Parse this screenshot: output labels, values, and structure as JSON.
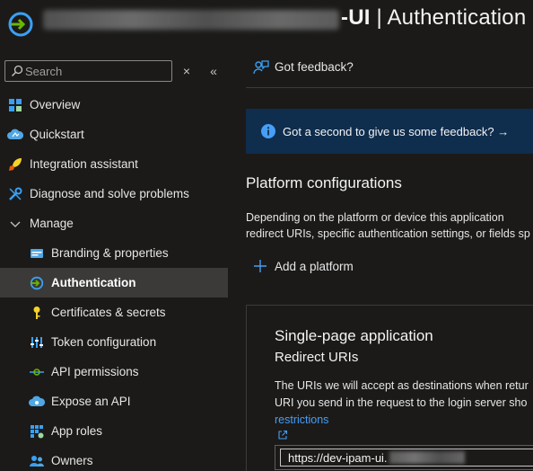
{
  "header": {
    "title_suffix_bold": "-UI",
    "separator": " | ",
    "blade_title": "Authentication"
  },
  "sidebar": {
    "search_placeholder": "Search",
    "close_glyph": "×",
    "collapse_glyph": "«",
    "items": [
      {
        "label": "Overview"
      },
      {
        "label": "Quickstart"
      },
      {
        "label": "Integration assistant"
      },
      {
        "label": "Diagnose and solve problems"
      },
      {
        "label": "Manage"
      },
      {
        "label": "Branding & properties"
      },
      {
        "label": "Authentication"
      },
      {
        "label": "Certificates & secrets"
      },
      {
        "label": "Token configuration"
      },
      {
        "label": "API permissions"
      },
      {
        "label": "Expose an API"
      },
      {
        "label": "App roles"
      },
      {
        "label": "Owners"
      }
    ]
  },
  "commandbar": {
    "feedback_label": "Got feedback?"
  },
  "banner": {
    "text": "Got a second to give us some feedback? →"
  },
  "platform": {
    "heading": "Platform configurations",
    "desc_line1": "Depending on the platform or device this application",
    "desc_line2": "redirect URIs, specific authentication settings, or fields sp",
    "add_label": "Add a platform"
  },
  "spa": {
    "title": "Single-page application",
    "subtitle": "Redirect URIs",
    "desc_line1": "The URIs we will accept as destinations when retur",
    "desc_line2": "URI you send in the request to the login server sho",
    "link_text": "restrictions",
    "uri_value": "https://dev-ipam-ui."
  },
  "colors": {
    "background": "#1b1a19",
    "selected": "#3b3a39",
    "banner": "#0f2d4d",
    "link": "#479ef5",
    "accent": "#0078d4"
  }
}
